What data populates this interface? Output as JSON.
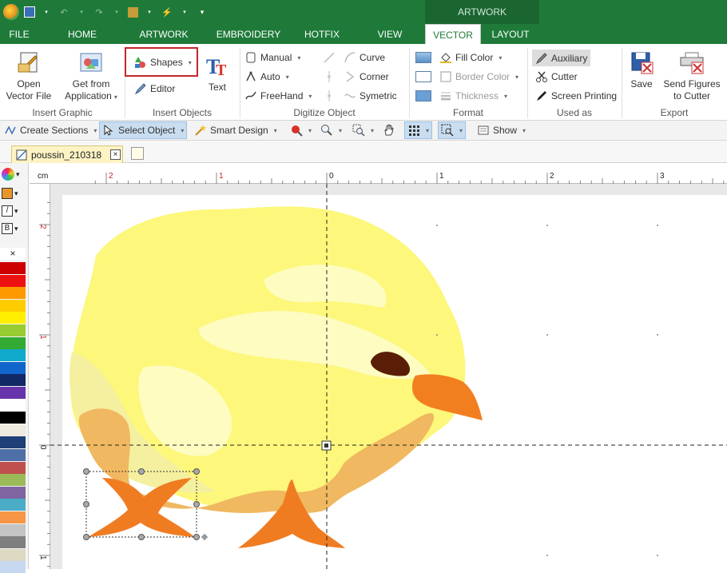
{
  "quick_access": {
    "icons": [
      "app-logo-icon",
      "save-icon",
      "undo-icon",
      "redo-icon",
      "clipboard-icon",
      "lightning-icon",
      "customize-icon"
    ]
  },
  "context_group": {
    "label": "ARTWORK"
  },
  "tabs": [
    {
      "label": "FILE"
    },
    {
      "label": "HOME"
    },
    {
      "label": "ARTWORK"
    },
    {
      "label": "EMBROIDERY"
    },
    {
      "label": "HOTFIX"
    },
    {
      "label": "VIEW"
    },
    {
      "label": "VECTOR"
    },
    {
      "label": "LAYOUT"
    }
  ],
  "active_tab": "VECTOR",
  "ribbon": {
    "insert_graphic": {
      "label": "Insert Graphic",
      "open_vector_file": "Open\nVector File",
      "open_vector_line1": "Open",
      "open_vector_line2": "Vector File",
      "get_from_line1": "Get from",
      "get_from_line2": "Application"
    },
    "insert_objects": {
      "label": "Insert Objects",
      "shapes": "Shapes",
      "editor": "Editor",
      "text": "Text"
    },
    "digitize_object": {
      "label": "Digitize Object",
      "manual": "Manual",
      "auto": "Auto",
      "freehand": "FreeHand",
      "curve": "Curve",
      "corner": "Corner",
      "symetric": "Symetric"
    },
    "format": {
      "label": "Format",
      "fill_color": "Fill Color",
      "border_color": "Border Color",
      "thickness": "Thickness"
    },
    "used_as": {
      "label": "Used as",
      "auxiliary": "Auxiliary",
      "cutter": "Cutter",
      "screen_printing": "Screen Printing"
    },
    "export": {
      "label": "Export",
      "save": "Save",
      "send_line1": "Send Figures",
      "send_line2": "to Cutter"
    }
  },
  "toolbar": {
    "create_sections": "Create Sections",
    "select_object": "Select Object",
    "smart_design": "Smart Design",
    "show": "Show"
  },
  "document": {
    "tab_name": "poussin_210318"
  },
  "ruler": {
    "unit": "cm",
    "top_ticks": [
      "2",
      "1",
      "0",
      "1",
      "2",
      "3"
    ],
    "left_ticks": [
      "2",
      "1",
      "0",
      "1"
    ]
  },
  "palette_colors": [
    "#cc0000",
    "#ee1111",
    "#ff9900",
    "#ffcc00",
    "#ffee00",
    "#99cc33",
    "#33aa33",
    "#11aacc",
    "#1166cc",
    "#112a66",
    "#6633aa",
    "#ffffff",
    "#000000",
    "#eeeae0",
    "#1f3f77",
    "#4f6fa8",
    "#c0504d",
    "#9bbb59",
    "#8064a2",
    "#4bacc6",
    "#f79646",
    "#c4c4c4",
    "#7f7f7f",
    "#ddd9c3",
    "#c6d9f0"
  ],
  "colors": {
    "accent_green": "#1f7a3a",
    "highlight_red": "#c0272d"
  }
}
